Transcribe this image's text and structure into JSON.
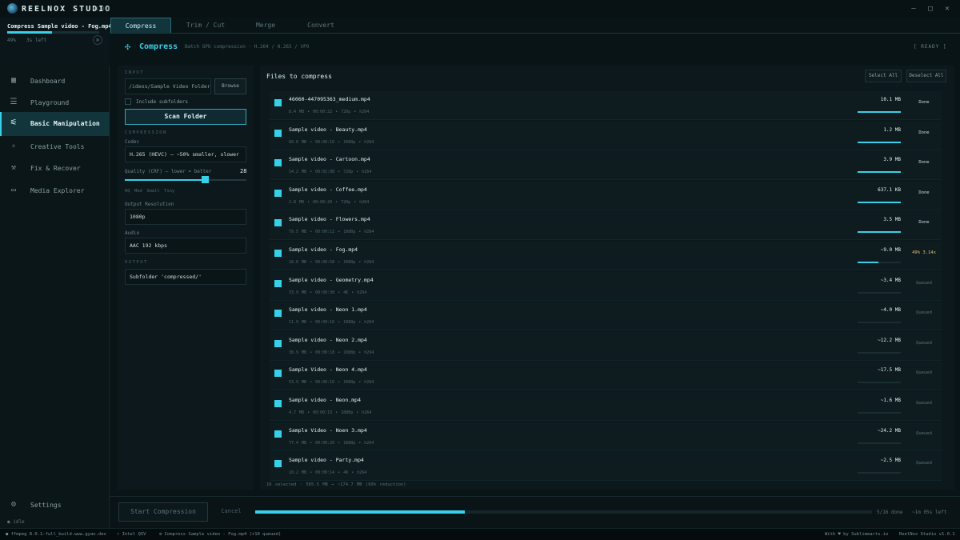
{
  "app": {
    "title": "REELNOX STUDIO",
    "version": "v1.0.1",
    "window_controls": {
      "minimize": "—",
      "maximize": "□",
      "close": "✕"
    }
  },
  "job": {
    "title": "Compress Sample video - Fog.mp4",
    "progress": 0.49,
    "percent_label": "49%",
    "time_left": "3s left",
    "close": "✕"
  },
  "tabs": [
    {
      "label": "Compress",
      "active": true
    },
    {
      "label": "Trim / Cut",
      "active": false
    },
    {
      "label": "Merge",
      "active": false
    },
    {
      "label": "Convert",
      "active": false
    }
  ],
  "sidebar": {
    "items": [
      {
        "label": "Dashboard",
        "icon": "grid-icon",
        "active": false
      },
      {
        "label": "Playground",
        "icon": "sliders-icon",
        "active": false
      },
      {
        "label": "Basic Manipulation",
        "icon": "adjust-icon",
        "active": true
      },
      {
        "label": "Creative Tools",
        "icon": "sparkle-icon",
        "active": false
      },
      {
        "label": "Fix & Recover",
        "icon": "wrench-icon",
        "active": false
      },
      {
        "label": "Media Explorer",
        "icon": "folder-icon",
        "active": false
      }
    ],
    "settings_label": "Settings",
    "idle_label": "● idle"
  },
  "header": {
    "title": "Compress",
    "subtitle": "Batch GPU compression · H.264 / H.265 / VP9",
    "status": "[ READY ]"
  },
  "settings": {
    "input_section": "INPUT",
    "input_path": "/ideos/Sample Video Folder",
    "browse_label": "Browse",
    "include_subfolders_label": "Include subfolders",
    "include_subfolders_checked": false,
    "scan_label": "Scan Folder",
    "compression_section": "COMPRESSION",
    "codec_label": "Codec",
    "codec_value": "H.265 (HEVC) — ~50% smaller, slower",
    "quality_label": "Quality (CRF) — lower = better",
    "quality_value": "28",
    "quality_fraction": 0.66,
    "presets": [
      "HQ",
      "Med",
      "Small",
      "Tiny"
    ],
    "resolution_label": "Output Resolution",
    "resolution_value": "1080p",
    "audio_label": "Audio",
    "audio_value": "AAC 192 kbps",
    "output_section": "OUTPUT",
    "output_value": "Subfolder 'compressed/'"
  },
  "files": {
    "title": "Files to compress",
    "select_all": "Select All",
    "deselect_all": "Deselect All",
    "rows": [
      {
        "name": "46060-447095363_medium.mp4",
        "meta": "8.4 MB  •  00:00:22  •  720p  •  h264",
        "size": "10.1 MB",
        "progress": 1.0,
        "status": "Done",
        "state": "done"
      },
      {
        "name": "Sample video -  Beauty.mp4",
        "meta": "60.0 MB  •  00:00:16  •  1080p  •  h264",
        "size": "1.2 MB",
        "progress": 1.0,
        "status": "Done",
        "state": "done"
      },
      {
        "name": "Sample video - Cartoon.mp4",
        "meta": "14.2 MB  •  00:01:08  •  720p  •  h264",
        "size": "3.9 MB",
        "progress": 1.0,
        "status": "Done",
        "state": "done"
      },
      {
        "name": "Sample video - Coffee.mp4",
        "meta": "2.8 MB  •  00:00:20  •  720p  •  h264",
        "size": "637.1 KB",
        "progress": 1.0,
        "status": "Done",
        "state": "done"
      },
      {
        "name": "Sample video - Flowers.mp4",
        "meta": "79.5 MB  •  00:00:11  •  1080p  •  h264",
        "size": "3.5 MB",
        "progress": 1.0,
        "status": "Done",
        "state": "done"
      },
      {
        "name": "Sample video - Fog.mp4",
        "meta": "18.0 MB  •  00:00:58  •  1080p  •  h264",
        "size": "~9.0 MB",
        "progress": 0.49,
        "status": "49% 3.14x",
        "state": "active"
      },
      {
        "name": "Sample video - Geometry.mp4",
        "meta": "33.9 MB  •  00:00:30  •  4K  •  h264",
        "size": "~3.4 MB",
        "progress": 0,
        "status": "Queued",
        "state": "queued"
      },
      {
        "name": "Sample video - Neon 1.mp4",
        "meta": "11.9 MB  •  00:00:16  •  1080p  •  h264",
        "size": "~4.0 MB",
        "progress": 0,
        "status": "Queued",
        "state": "queued"
      },
      {
        "name": "Sample video - Neon 2.mp4",
        "meta": "38.9 MB  •  00:00:18  •  1080p  •  h264",
        "size": "~12.2 MB",
        "progress": 0,
        "status": "Queued",
        "state": "queued"
      },
      {
        "name": "Sample Video - Neon 4.mp4",
        "meta": "53.9 MB  •  00:00:16  •  1080p  •  h264",
        "size": "~17.5 MB",
        "progress": 0,
        "status": "Queued",
        "state": "queued"
      },
      {
        "name": "Sample video - Neon.mp4",
        "meta": "4.7 MB  •  00:00:13  •  1080p  •  h264",
        "size": "~1.6 MB",
        "progress": 0,
        "status": "Queued",
        "state": "queued"
      },
      {
        "name": "Sample Video - Noen 3.mp4",
        "meta": "77.4 MB  •  00:00:20  •  1080p  •  h264",
        "size": "~24.2 MB",
        "progress": 0,
        "status": "Queued",
        "state": "queued"
      },
      {
        "name": "Sample video - Party.mp4",
        "meta": "10.2 MB  •  00:00:14  •  4K  •  h264",
        "size": "~2.5 MB",
        "progress": 0,
        "status": "Queued",
        "state": "queued"
      }
    ],
    "footer": "16 selected  ·  565.5 MB → ~174.7 MB  (69% reduction)"
  },
  "actions": {
    "start_label": "Start Compression",
    "cancel_label": "Cancel",
    "total_progress": 0.34,
    "done_label": "5/16 done",
    "time_left_label": "~1m 05s left"
  },
  "statusbar": {
    "ffmpeg": "● ffmpeg 8.0.1-full_build-www.gyan.dev",
    "gpu": "⚡ Intel QSV",
    "job": "⚙ Compress Sample video - Fog.mp4  (+10 queued)",
    "credit": "With ♥ by Sublimearts.io",
    "version": "ReelNox Studio v1.0.1"
  },
  "colors": {
    "accent": "#38d0e8",
    "background": "#091417",
    "panel": "#0c181b",
    "active_status": "#e0c080"
  }
}
